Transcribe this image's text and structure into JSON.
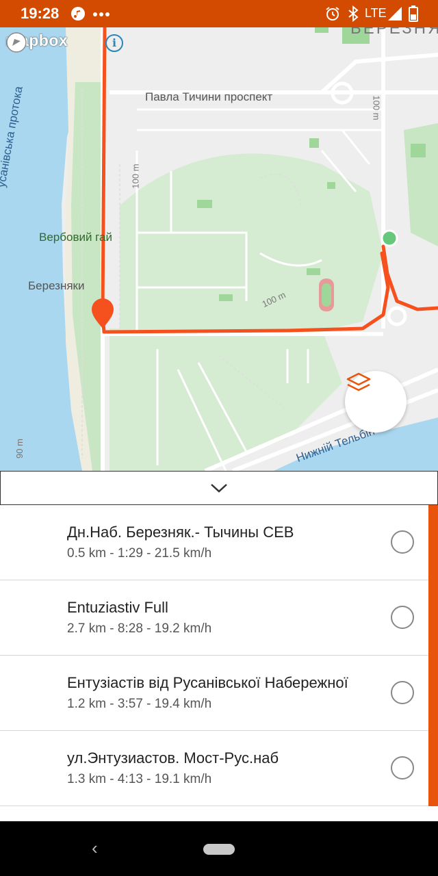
{
  "status_bar": {
    "time": "19:28",
    "network": "LTE",
    "icons": [
      "music-icon",
      "more-dots-icon",
      "alarm-icon",
      "bluetooth-icon",
      "signal-icon",
      "battery-icon"
    ]
  },
  "map": {
    "attribution": "mapbox",
    "labels": {
      "prospect": "Павла Тичини проспект",
      "grove": "Вербовий гай",
      "district": "Березняки",
      "channel": "усанівська протока",
      "telbin": "Нижній Тельбін",
      "district_top": "БЕРЕЗНЯ",
      "scale_100_a": "100 m",
      "scale_100_b": "100 m",
      "scale_100_c": "100 m",
      "scale_90": "90 m"
    },
    "route_color": "#f4511e",
    "start_color": "#66c87a"
  },
  "segments": [
    {
      "name": "Дн.Наб. Березняк.- Тычины СЕВ",
      "stats": "0.5 km - 1:29 - 21.5 km/h"
    },
    {
      "name": "Entuziastiv Full",
      "stats": "2.7 km - 8:28 - 19.2 km/h"
    },
    {
      "name": "Ентузіастів від Русанівської Набережної",
      "stats": "1.2 km - 3:57 - 19.4 km/h"
    },
    {
      "name": "ул.Энтузиастов. Мост-Рус.наб",
      "stats": "1.3 km - 4:13 - 19.1 km/h"
    }
  ],
  "colors": {
    "accent": "#e8540b",
    "status_bar": "#d34b00"
  }
}
